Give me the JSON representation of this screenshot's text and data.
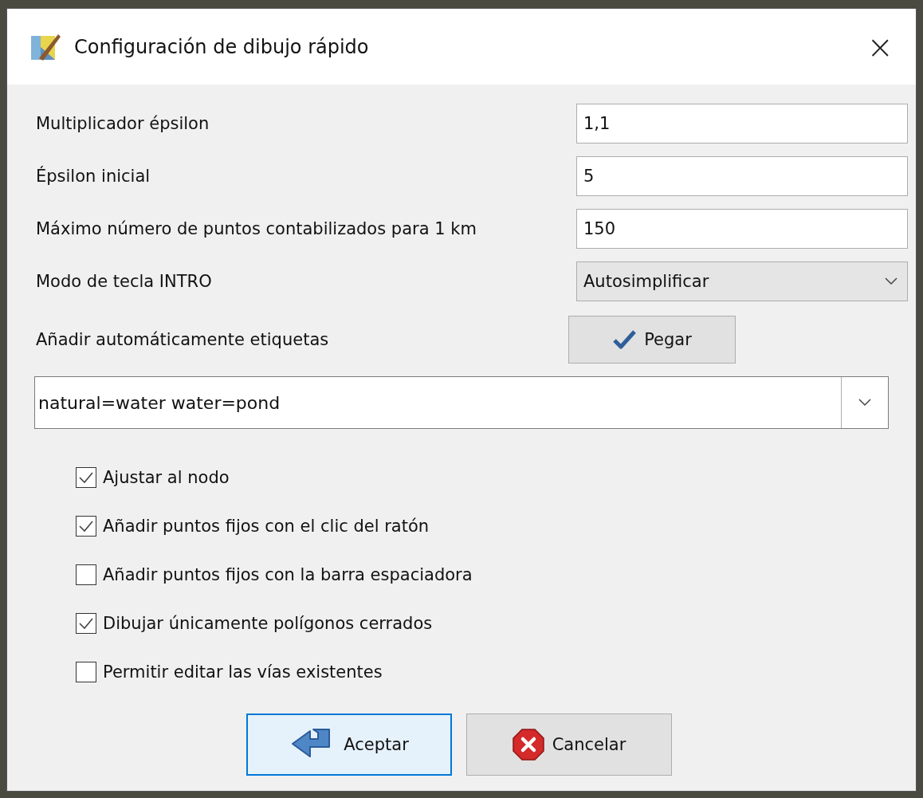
{
  "window": {
    "title": "Configuración de dibujo rápido",
    "close": "×"
  },
  "fields": [
    {
      "kind": "text",
      "label": "Multiplicador épsilon",
      "value": "1,1"
    },
    {
      "kind": "text",
      "label": "Épsilon inicial",
      "value": "5"
    },
    {
      "kind": "text",
      "label": "Máximo número de puntos contabilizados para 1 km",
      "value": "150"
    },
    {
      "kind": "select",
      "label": "Modo de tecla INTRO",
      "value": "Autosimplificar"
    }
  ],
  "tags": {
    "label": "Añadir automáticamente etiquetas",
    "paste_button": "Pegar",
    "value": "natural=water water=pond"
  },
  "options": [
    {
      "label": "Ajustar al nodo",
      "checked": true
    },
    {
      "label": "Añadir puntos fijos con el clic del ratón",
      "checked": true
    },
    {
      "label": "Añadir puntos fijos con la barra espaciadora",
      "checked": false
    },
    {
      "label": "Dibujar únicamente polígonos cerrados",
      "checked": true
    },
    {
      "label": "Permitir editar las vías existentes",
      "checked": false
    }
  ],
  "buttons": [
    {
      "kind": "ok",
      "label": "Aceptar",
      "selected": true
    },
    {
      "kind": "cancel",
      "label": "Cancelar",
      "selected": false
    }
  ]
}
